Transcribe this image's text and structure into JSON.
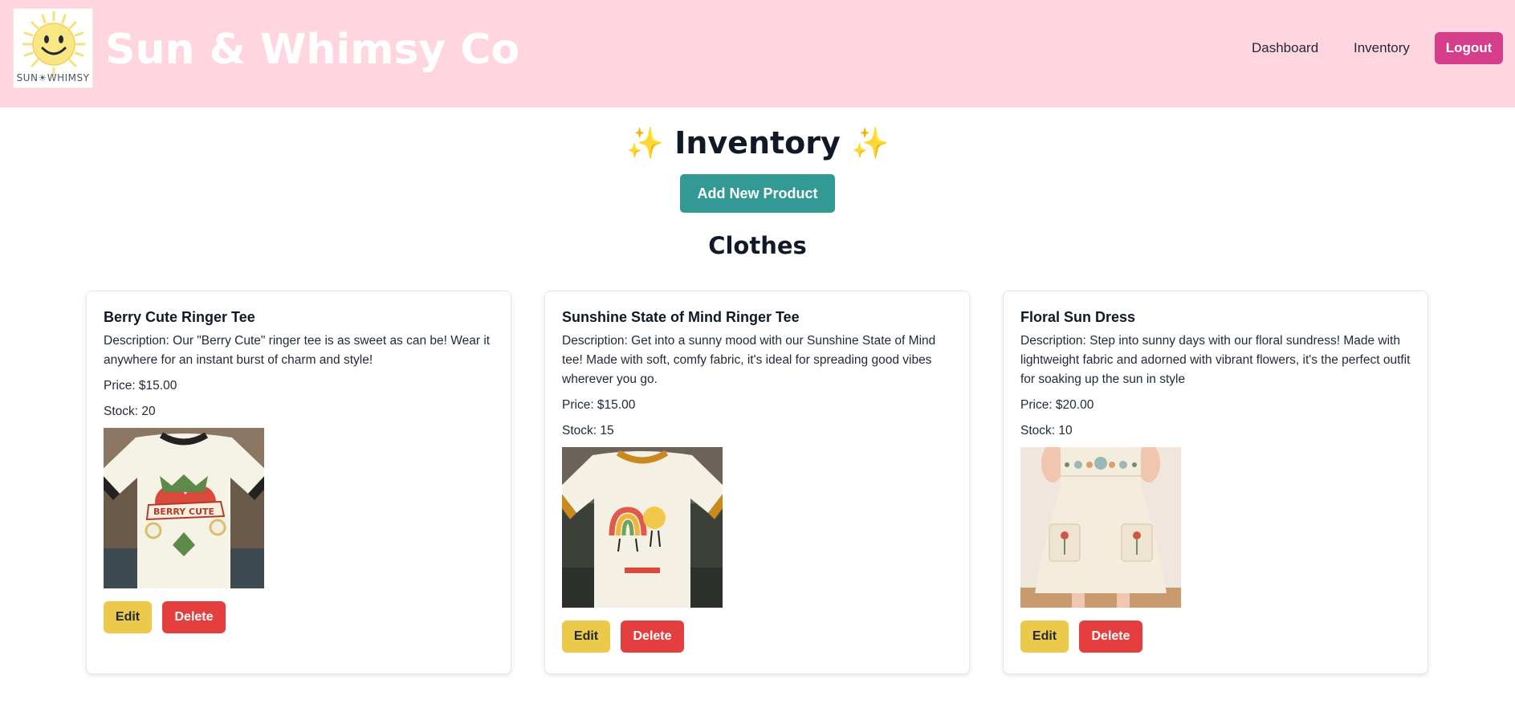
{
  "header": {
    "logo_text": "SUN☀WHIMSY",
    "brand": "Sun & Whimsy Co",
    "nav": {
      "dashboard": "Dashboard",
      "inventory": "Inventory",
      "logout": "Logout"
    }
  },
  "main": {
    "title": "Inventory",
    "sparkle": "✨",
    "add_button": "Add New Product",
    "section": "Clothes"
  },
  "products": [
    {
      "name": "Berry Cute Ringer Tee",
      "description": "Description: Our \"Berry Cute\" ringer tee is as sweet as can be! Wear it anywhere for an instant burst of charm and style!",
      "price": "Price: $15.00",
      "stock": "Stock: 20",
      "image_text": "BERRY CUTE",
      "edit": "Edit",
      "delete": "Delete"
    },
    {
      "name": "Sunshine State of Mind Ringer Tee",
      "description": "Description: Get into a sunny mood with our Sunshine State of Mind tee! Made with soft, comfy fabric, it's ideal for spreading good vibes wherever you go.",
      "price": "Price: $15.00",
      "stock": "Stock: 15",
      "edit": "Edit",
      "delete": "Delete"
    },
    {
      "name": "Floral Sun Dress",
      "description": "Description: Step into sunny days with our floral sundress! Made with lightweight fabric and adorned with vibrant flowers, it's the perfect outfit for soaking up the sun in style",
      "price": "Price: $20.00",
      "stock": "Stock: 10",
      "edit": "Edit",
      "delete": "Delete"
    }
  ],
  "colors": {
    "header_bg": "#ffd6e0",
    "logout": "#d63d8a",
    "add_button": "#339994",
    "edit": "#ecc94b",
    "delete": "#e53e3e",
    "sparkle": "#f5b82e"
  }
}
